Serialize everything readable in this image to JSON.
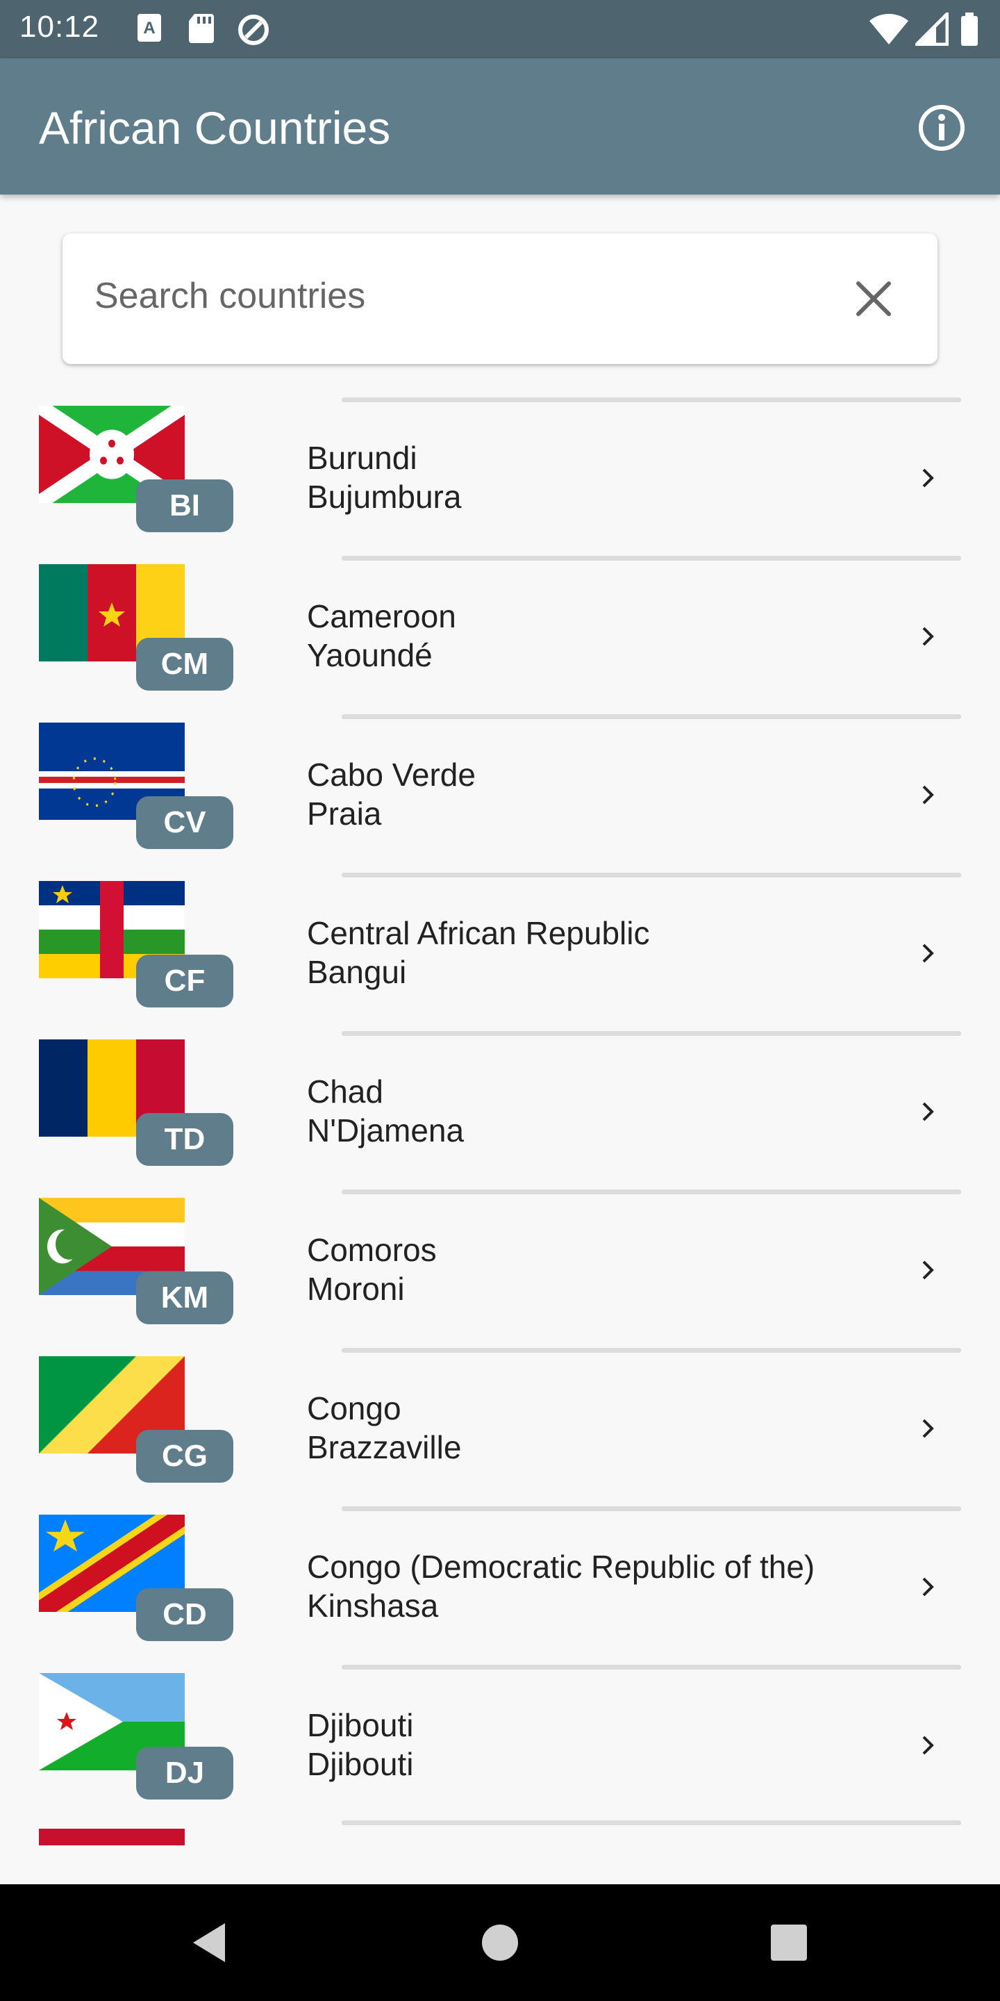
{
  "status_bar": {
    "time": "10:12",
    "icons": [
      "a-notification-icon",
      "sd-card-icon",
      "data-saver-icon",
      "wifi-icon",
      "signal-icon",
      "battery-icon"
    ]
  },
  "app_bar": {
    "title": "African Countries",
    "info_icon": "info-icon"
  },
  "search": {
    "placeholder": "Search countries",
    "value": "",
    "clear_icon": "close-icon"
  },
  "countries": [
    {
      "code": "BI",
      "name": "Burundi",
      "capital": "Bujumbura"
    },
    {
      "code": "CM",
      "name": "Cameroon",
      "capital": "Yaoundé"
    },
    {
      "code": "CV",
      "name": "Cabo Verde",
      "capital": "Praia"
    },
    {
      "code": "CF",
      "name": "Central African Republic",
      "capital": "Bangui"
    },
    {
      "code": "TD",
      "name": "Chad",
      "capital": "N'Djamena"
    },
    {
      "code": "KM",
      "name": "Comoros",
      "capital": "Moroni"
    },
    {
      "code": "CG",
      "name": "Congo",
      "capital": "Brazzaville"
    },
    {
      "code": "CD",
      "name": "Congo (Democratic Republic of the)",
      "capital": "Kinshasa"
    },
    {
      "code": "DJ",
      "name": "Djibouti",
      "capital": "Djibouti"
    }
  ],
  "colors": {
    "status_bar": "#4e6570",
    "app_bar": "#607d8b",
    "badge": "#607d8b",
    "background": "#f8f8f8"
  },
  "nav_bar": {
    "icons": [
      "back-icon",
      "home-icon",
      "recents-icon"
    ]
  }
}
